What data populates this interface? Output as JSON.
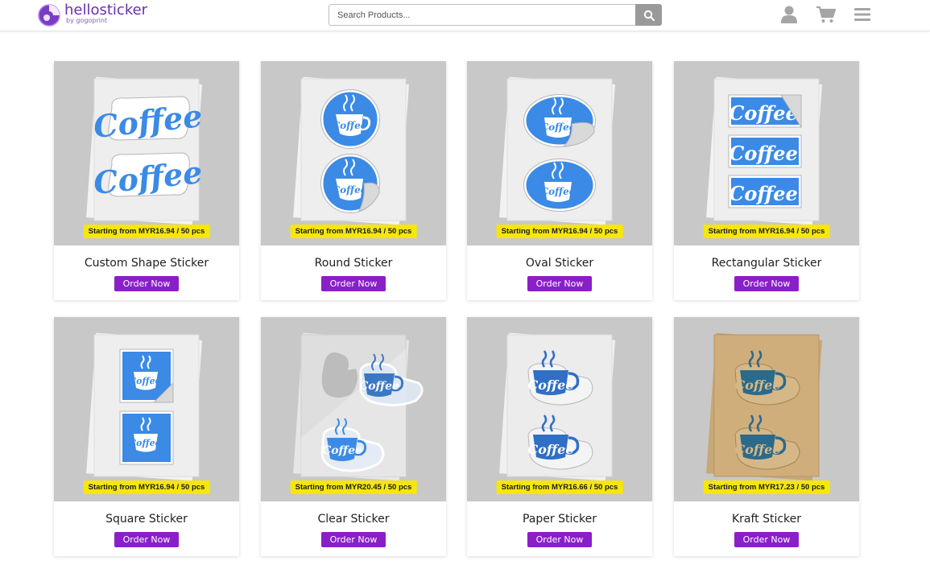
{
  "header": {
    "logo": {
      "name": "hellosticker",
      "sub": "by gogoprint"
    },
    "search": {
      "placeholder": "Search Products..."
    },
    "icons": [
      "user-icon",
      "cart-icon",
      "menu-icon"
    ]
  },
  "colors": {
    "brand": "#6a2fb0",
    "order_button": "#8a1fc8",
    "price_badge": "#f5e70b",
    "card_image_bg": "#c8c8c8",
    "sticker_blue": "#3b8ae6",
    "kraft_ink": "#2b6a8a"
  },
  "products": [
    {
      "title": "Custom Shape Sticker",
      "price": "Starting from MYR16.94 / 50 pcs",
      "cta": "Order Now"
    },
    {
      "title": "Round Sticker",
      "price": "Starting from MYR16.94 / 50 pcs",
      "cta": "Order Now"
    },
    {
      "title": "Oval Sticker",
      "price": "Starting from MYR16.94 / 50 pcs",
      "cta": "Order Now"
    },
    {
      "title": "Rectangular Sticker",
      "price": "Starting from MYR16.94 / 50 pcs",
      "cta": "Order Now"
    },
    {
      "title": "Square Sticker",
      "price": "Starting from MYR16.94 / 50 pcs",
      "cta": "Order Now"
    },
    {
      "title": "Clear Sticker",
      "price": "Starting from MYR20.45 / 50 pcs",
      "cta": "Order Now"
    },
    {
      "title": "Paper Sticker",
      "price": "Starting from MYR16.66 / 50 pcs",
      "cta": "Order Now"
    },
    {
      "title": "Kraft Sticker",
      "price": "Starting from MYR17.23 / 50 pcs",
      "cta": "Order Now"
    }
  ],
  "sticker_text": "Coffee"
}
